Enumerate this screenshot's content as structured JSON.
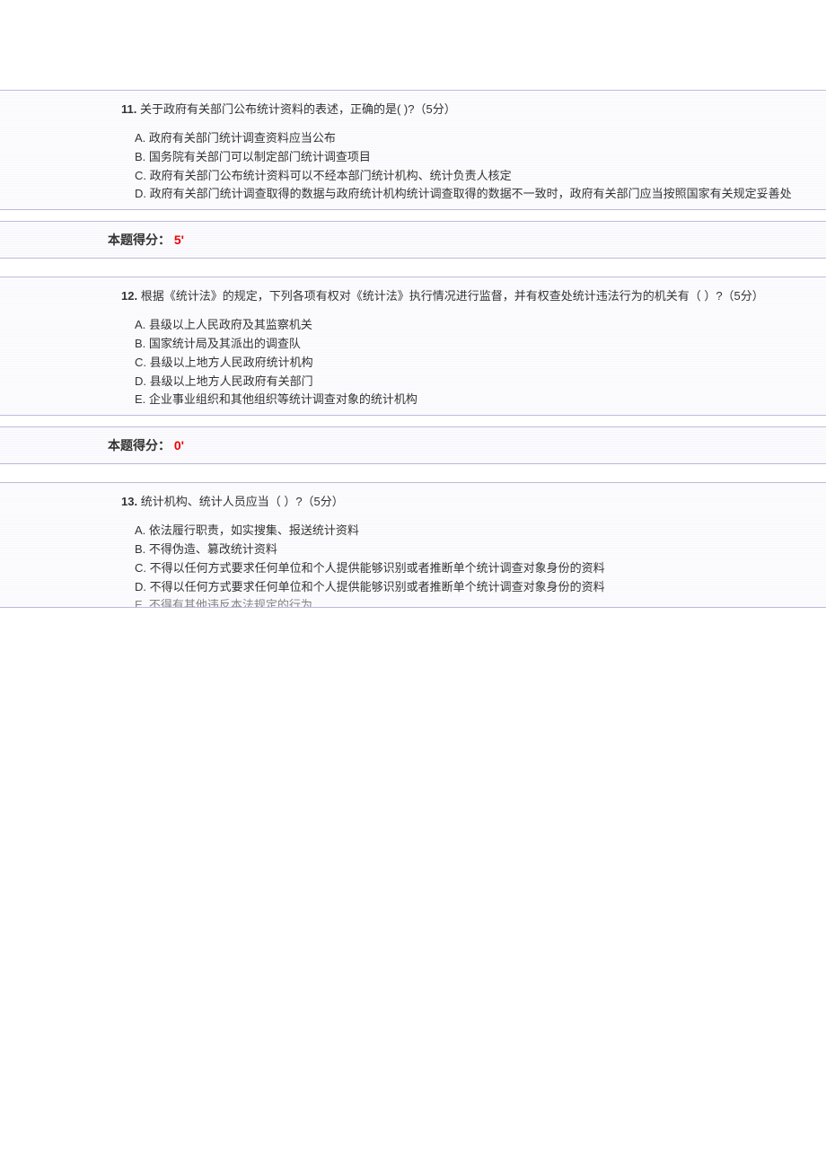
{
  "questions": [
    {
      "num": "11.",
      "text": "关于政府有关部门公布统计资料的表述，正确的是( )?（5分）",
      "options": [
        "A. 政府有关部门统计调查资料应当公布",
        "B. 国务院有关部门可以制定部门统计调查项目",
        "C. 政府有关部门公布统计资料可以不经本部门统计机构、统计负责人核定",
        "D. 政府有关部门统计调查取得的数据与政府统计机构统计调查取得的数据不一致时，政府有关部门应当按照国家有关规定妥善处"
      ],
      "score_label": "本题得分：",
      "score_value": "5'"
    },
    {
      "num": "12.",
      "text": "根据《统计法》的规定，下列各项有权对《统计法》执行情况进行监督，并有权查处统计违法行为的机关有（ ）?（5分）",
      "options": [
        "A. 县级以上人民政府及其监察机关",
        "B. 国家统计局及其派出的调查队",
        "C. 县级以上地方人民政府统计机构",
        "D. 县级以上地方人民政府有关部门",
        "E. 企业事业组织和其他组织等统计调查对象的统计机构"
      ],
      "score_label": "本题得分：",
      "score_value": "0'"
    },
    {
      "num": "13.",
      "text": "统计机构、统计人员应当（ ）?（5分）",
      "options": [
        "A. 依法履行职责，如实搜集、报送统计资料",
        "B. 不得伪造、篡改统计资料",
        "C. 不得以任何方式要求任何单位和个人提供能够识别或者推断单个统计调查对象身份的资料",
        "D. 不得以任何方式要求任何单位和个人提供能够识别或者推断单个统计调查对象身份的资料",
        "E. 不得有其他违反本法规定的行为"
      ]
    }
  ]
}
